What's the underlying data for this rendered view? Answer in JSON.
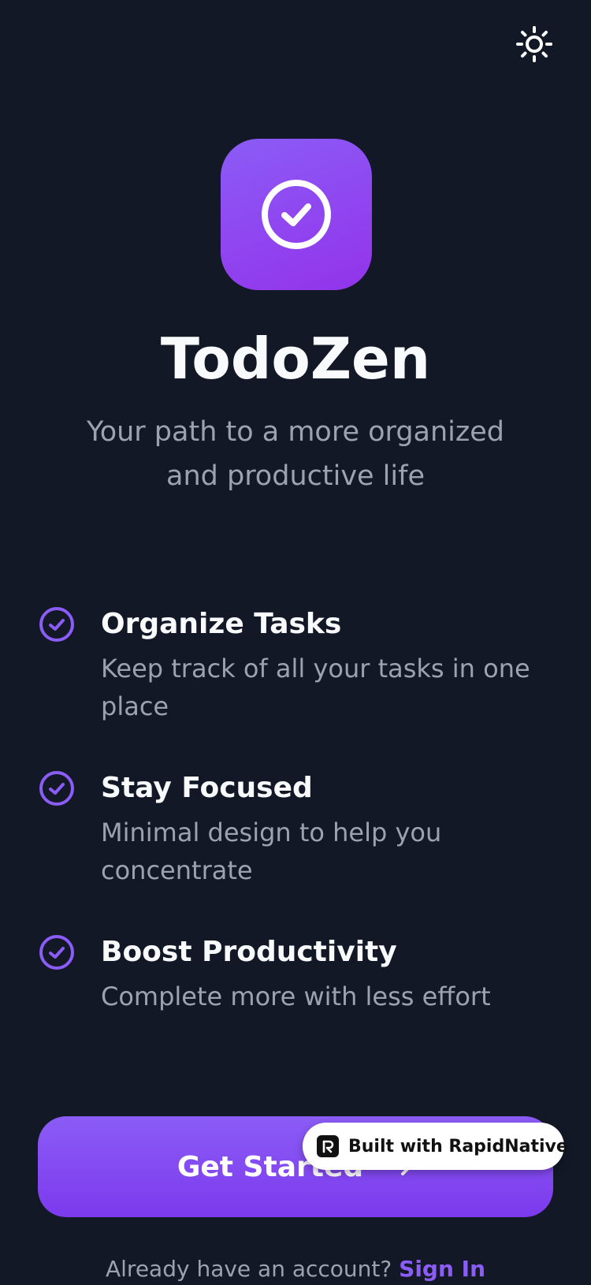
{
  "header": {
    "theme_toggle_icon": "sun-icon"
  },
  "hero": {
    "app_icon": "check-circle-icon",
    "title": "TodoZen",
    "tagline": "Your path to a more organized and productive life"
  },
  "features": [
    {
      "icon": "check-circle-icon",
      "title": "Organize Tasks",
      "description": "Keep track of all your tasks in one place"
    },
    {
      "icon": "check-circle-icon",
      "title": "Stay Focused",
      "description": "Minimal design to help you concentrate"
    },
    {
      "icon": "check-circle-icon",
      "title": "Boost Productivity",
      "description": "Complete more with less effort"
    }
  ],
  "cta": {
    "label": "Get Started",
    "icon": "arrow-right-icon"
  },
  "badge": {
    "label": "Built with RapidNative",
    "icon": "rapidnative-logo-icon"
  },
  "footer": {
    "prompt": "Already have an account?",
    "link": "Sign In"
  },
  "colors": {
    "background": "#121826",
    "accent": "#8b5cf6",
    "muted_text": "#9ca3af",
    "primary_text": "#f8fafc"
  }
}
